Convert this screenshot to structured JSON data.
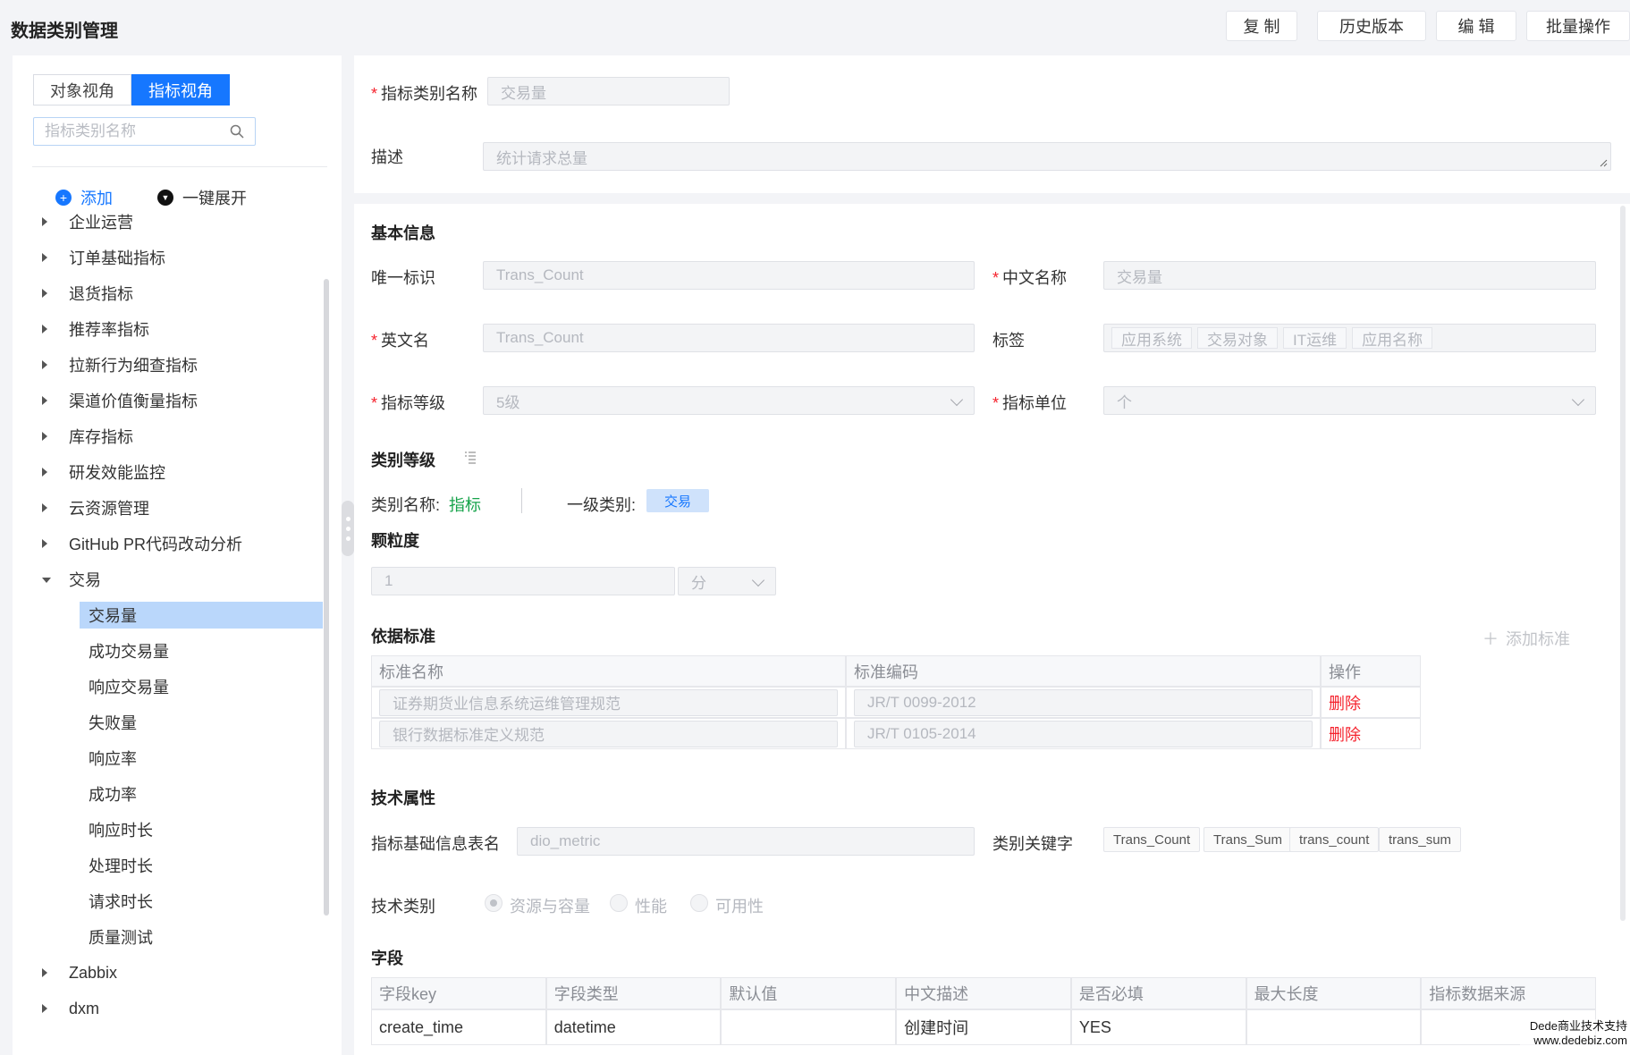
{
  "header": {
    "title": "数据类别管理",
    "buttons": {
      "copy": "复 制",
      "history": "历史版本",
      "edit": "编 辑",
      "batch": "批量操作"
    }
  },
  "sidebar": {
    "tabs": [
      {
        "label": "对象视角",
        "active": false
      },
      {
        "label": "指标视角",
        "active": true
      }
    ],
    "search_placeholder": "指标类别名称",
    "add_label": "添加",
    "expand_label": "一键展开",
    "tree": [
      {
        "label": "企业运营",
        "expanded": false
      },
      {
        "label": "订单基础指标",
        "expanded": false
      },
      {
        "label": "退货指标",
        "expanded": false
      },
      {
        "label": "推荐率指标",
        "expanded": false
      },
      {
        "label": "拉新行为细查指标",
        "expanded": false
      },
      {
        "label": "渠道价值衡量指标",
        "expanded": false
      },
      {
        "label": "库存指标",
        "expanded": false
      },
      {
        "label": "研发效能监控",
        "expanded": false
      },
      {
        "label": "云资源管理",
        "expanded": false
      },
      {
        "label": "GitHub PR代码改动分析",
        "expanded": false
      },
      {
        "label": "交易",
        "expanded": true,
        "children": [
          "交易量",
          "成功交易量",
          "响应交易量",
          "失败量",
          "响应率",
          "成功率",
          "响应时长",
          "处理时长",
          "请求时长",
          "质量测试"
        ],
        "selected_child": "交易量"
      },
      {
        "label": "Zabbix",
        "expanded": false
      },
      {
        "label": "dxm",
        "expanded": false
      }
    ]
  },
  "top_form": {
    "name_label": "指标类别名称",
    "name_value": "交易量",
    "desc_label": "描述",
    "desc_value": "统计请求总量"
  },
  "basic": {
    "title": "基本信息",
    "uid_label": "唯一标识",
    "uid_value": "Trans_Count",
    "cn_name_label": "中文名称",
    "cn_name_value": "交易量",
    "en_name_label": "英文名",
    "en_name_value": "Trans_Count",
    "tags_label": "标签",
    "tags": [
      "应用系统",
      "交易对象",
      "IT运维",
      "应用名称"
    ],
    "level_label": "指标等级",
    "level_value": "5级",
    "unit_label": "指标单位",
    "unit_value": "个"
  },
  "category_level": {
    "title": "类别等级",
    "cat_name_label": "类别名称:",
    "cat_name_value": "指标",
    "level1_label": "一级类别:",
    "level1_value": "交易",
    "accent_color": "#16a34a"
  },
  "granularity": {
    "title": "颗粒度",
    "value": "1",
    "unit": "分"
  },
  "standards": {
    "title": "依据标准",
    "add_label": "添加标准",
    "columns": [
      "标准名称",
      "标准编码",
      "操作"
    ],
    "rows": [
      {
        "name": "证券期货业信息系统运维管理规范",
        "code": "JR/T 0099-2012",
        "action": "删除"
      },
      {
        "name": "银行数据标准定义规范",
        "code": "JR/T 0105-2014",
        "action": "删除"
      }
    ]
  },
  "tech": {
    "title": "技术属性",
    "table_label": "指标基础信息表名",
    "table_value": "dio_metric",
    "keywords_label": "类别关键字",
    "keywords": [
      "Trans_Count",
      "Trans_Sum",
      "trans_count",
      "trans_sum"
    ],
    "type_label": "技术类别",
    "types": [
      {
        "label": "资源与容量",
        "checked": true
      },
      {
        "label": "性能",
        "checked": false
      },
      {
        "label": "可用性",
        "checked": false
      }
    ]
  },
  "fields": {
    "title": "字段",
    "columns": [
      "字段key",
      "字段类型",
      "默认值",
      "中文描述",
      "是否必填",
      "最大长度",
      "指标数据来源"
    ],
    "rows": [
      [
        "create_time",
        "datetime",
        "",
        "创建时间",
        "YES",
        "",
        ""
      ]
    ]
  },
  "watermark": {
    "line1": "Dede商业技术支持",
    "line2": "www.dedebiz.com"
  }
}
